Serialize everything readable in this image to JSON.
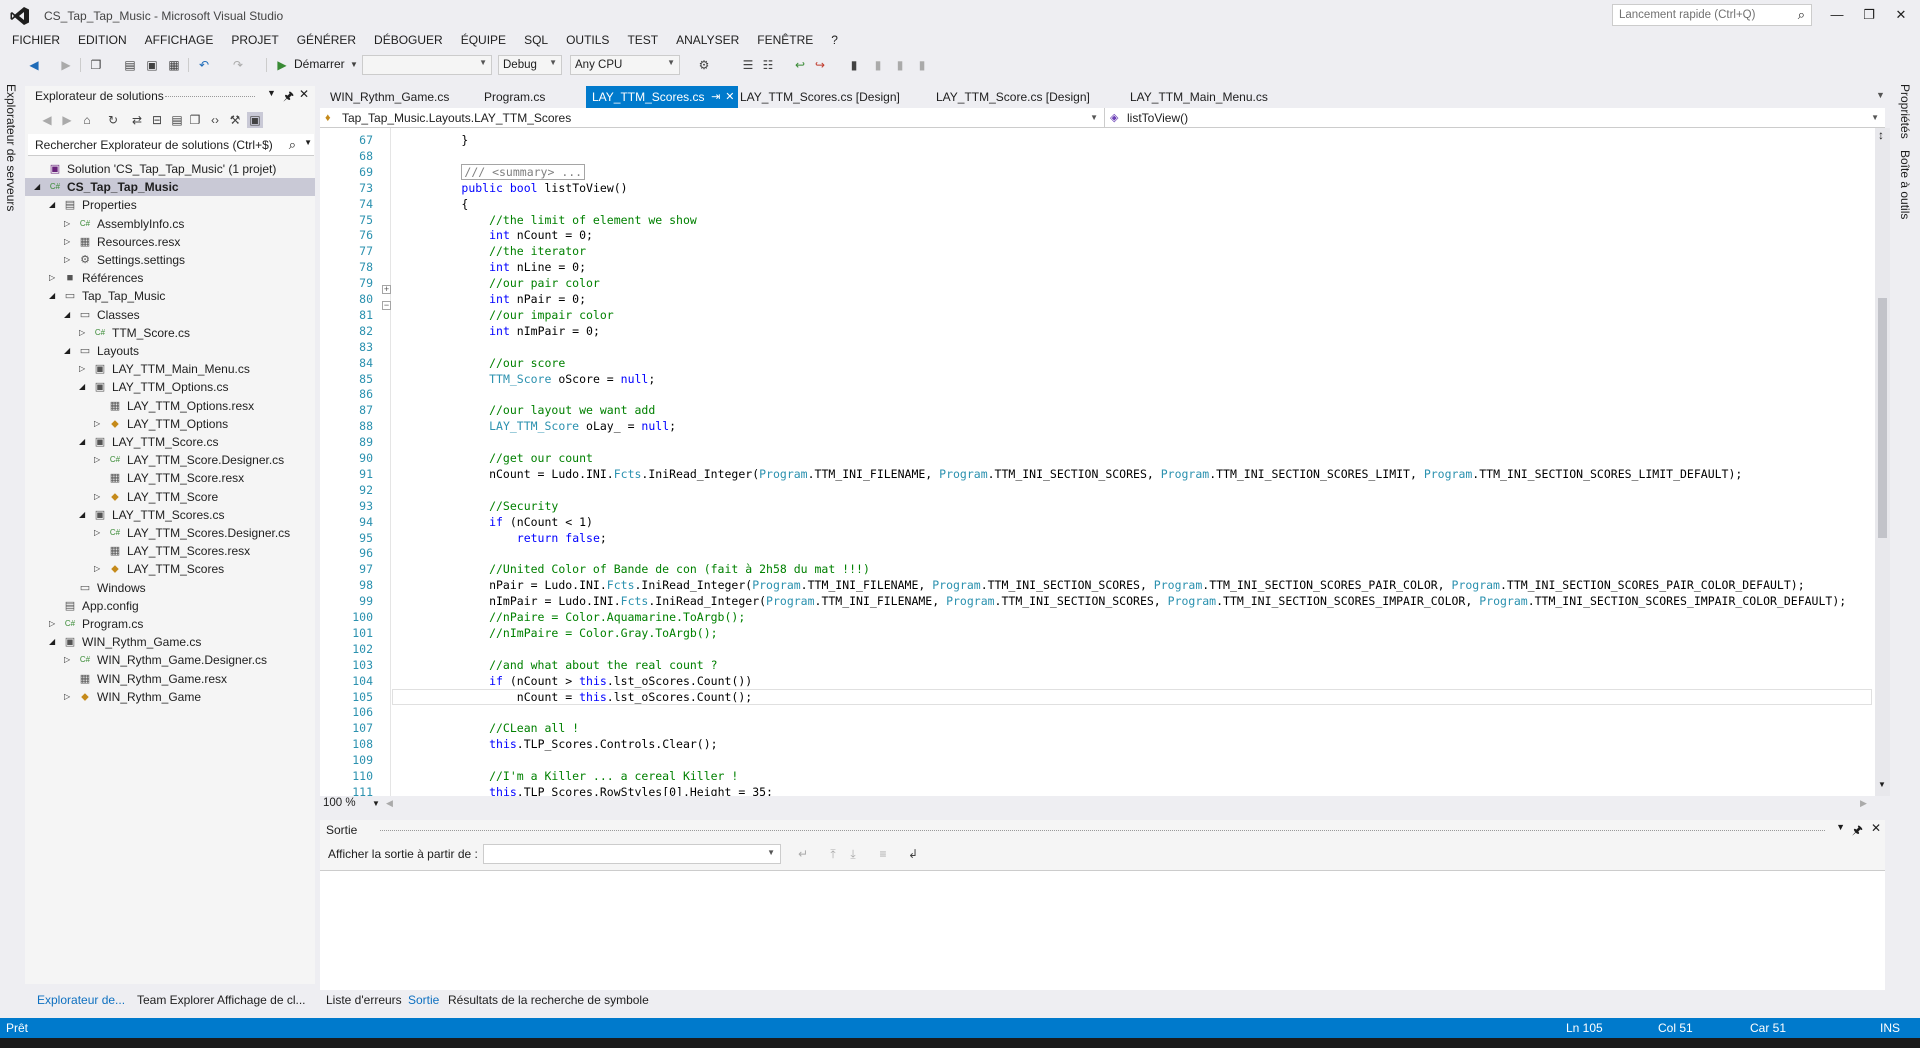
{
  "window": {
    "title": "CS_Tap_Tap_Music - Microsoft Visual Studio",
    "quick_launch_placeholder": "Lancement rapide (Ctrl+Q)"
  },
  "menu": [
    "FICHIER",
    "EDITION",
    "AFFICHAGE",
    "PROJET",
    "GÉNÉRER",
    "DÉBOGUER",
    "ÉQUIPE",
    "SQL",
    "OUTILS",
    "TEST",
    "ANALYSER",
    "FENÊTRE",
    "?"
  ],
  "toolbar": {
    "start_label": "Démarrer",
    "config": "Debug",
    "platform": "Any CPU",
    "target_combo": ""
  },
  "left_strip": {
    "server_explorer": "Explorateur de serveurs"
  },
  "right_strip": {
    "properties": "Propriétés",
    "toolbox": "Boîte à outils"
  },
  "solution_explorer": {
    "title": "Explorateur de solutions",
    "search_placeholder": "Rechercher Explorateur de solutions (Ctrl+$)",
    "tree": [
      {
        "label": "Solution 'CS_Tap_Tap_Music' (1 projet)",
        "icon": "solution-icon",
        "expander": "",
        "selected": false
      },
      {
        "label": "CS_Tap_Tap_Music",
        "icon": "csharp-project-icon",
        "expander": "◢",
        "selected": true
      },
      {
        "label": "Properties",
        "icon": "properties-folder-icon",
        "expander": "◢",
        "selected": false
      },
      {
        "label": "AssemblyInfo.cs",
        "icon": "csharp-file-icon",
        "expander": "▷",
        "selected": false
      },
      {
        "label": "Resources.resx",
        "icon": "resx-file-icon",
        "expander": "▷",
        "selected": false
      },
      {
        "label": "Settings.settings",
        "icon": "settings-file-icon",
        "expander": "▷",
        "selected": false
      },
      {
        "label": "Références",
        "icon": "references-icon",
        "expander": "▷",
        "selected": false
      },
      {
        "label": "Tap_Tap_Music",
        "icon": "folder-icon",
        "expander": "◢",
        "selected": false
      },
      {
        "label": "Classes",
        "icon": "folder-icon",
        "expander": "◢",
        "selected": false
      },
      {
        "label": "TTM_Score.cs",
        "icon": "csharp-file-icon",
        "expander": "▷",
        "selected": false
      },
      {
        "label": "Layouts",
        "icon": "folder-icon",
        "expander": "◢",
        "selected": false
      },
      {
        "label": "LAY_TTM_Main_Menu.cs",
        "icon": "form-file-icon",
        "expander": "▷",
        "selected": false
      },
      {
        "label": "LAY_TTM_Options.cs",
        "icon": "form-file-icon",
        "expander": "◢",
        "selected": false
      },
      {
        "label": "LAY_TTM_Options.resx",
        "icon": "resx-file-icon",
        "expander": "",
        "selected": false
      },
      {
        "label": "LAY_TTM_Options",
        "icon": "class-icon",
        "expander": "▷",
        "selected": false
      },
      {
        "label": "LAY_TTM_Score.cs",
        "icon": "form-file-icon",
        "expander": "◢",
        "selected": false
      },
      {
        "label": "LAY_TTM_Score.Designer.cs",
        "icon": "csharp-file-icon",
        "expander": "▷",
        "selected": false
      },
      {
        "label": "LAY_TTM_Score.resx",
        "icon": "resx-file-icon",
        "expander": "",
        "selected": false
      },
      {
        "label": "LAY_TTM_Score",
        "icon": "class-icon",
        "expander": "▷",
        "selected": false
      },
      {
        "label": "LAY_TTM_Scores.cs",
        "icon": "form-file-icon",
        "expander": "◢",
        "selected": false
      },
      {
        "label": "LAY_TTM_Scores.Designer.cs",
        "icon": "csharp-file-icon",
        "expander": "▷",
        "selected": false
      },
      {
        "label": "LAY_TTM_Scores.resx",
        "icon": "resx-file-icon",
        "expander": "",
        "selected": false
      },
      {
        "label": "LAY_TTM_Scores",
        "icon": "class-icon",
        "expander": "▷",
        "selected": false
      },
      {
        "label": "Windows",
        "icon": "folder-icon",
        "expander": "",
        "selected": false
      },
      {
        "label": "App.config",
        "icon": "config-file-icon",
        "expander": "",
        "selected": false
      },
      {
        "label": "Program.cs",
        "icon": "csharp-file-icon",
        "expander": "▷",
        "selected": false
      },
      {
        "label": "WIN_Rythm_Game.cs",
        "icon": "form-file-icon",
        "expander": "◢",
        "selected": false
      },
      {
        "label": "WIN_Rythm_Game.Designer.cs",
        "icon": "csharp-file-icon",
        "expander": "▷",
        "selected": false
      },
      {
        "label": "WIN_Rythm_Game.resx",
        "icon": "resx-file-icon",
        "expander": "",
        "selected": false
      },
      {
        "label": "WIN_Rythm_Game",
        "icon": "class-icon",
        "expander": "▷",
        "selected": false
      }
    ],
    "bottom_tabs": [
      "Explorateur de...",
      "Team Explorer",
      "Affichage de cl..."
    ]
  },
  "doc_tabs": [
    {
      "label": "WIN_Rythm_Game.cs",
      "active": false
    },
    {
      "label": "Program.cs",
      "active": false
    },
    {
      "label": "LAY_TTM_Scores.cs",
      "active": true
    },
    {
      "label": "LAY_TTM_Scores.cs [Design]",
      "active": false
    },
    {
      "label": "LAY_TTM_Score.cs [Design]",
      "active": false
    },
    {
      "label": "LAY_TTM_Main_Menu.cs",
      "active": false
    }
  ],
  "navbar": {
    "class_path": "Tap_Tap_Music.Layouts.LAY_TTM_Scores",
    "member": "listToView()"
  },
  "editor": {
    "zoom": "100 %",
    "lines": [
      {
        "n": "67",
        "tokens": [
          [
            "",
            "        }"
          ]
        ]
      },
      {
        "n": "68",
        "tokens": [
          [
            "",
            ""
          ]
        ]
      },
      {
        "n": "69",
        "tokens": [
          [
            "",
            "        "
          ],
          [
            "box",
            "/// <summary> ..."
          ]
        ]
      },
      {
        "n": "73",
        "tokens": [
          [
            "",
            "        "
          ],
          [
            "kw",
            "public"
          ],
          [
            "",
            " "
          ],
          [
            "kw",
            "bool"
          ],
          [
            "",
            " listToView()"
          ]
        ]
      },
      {
        "n": "74",
        "tokens": [
          [
            "",
            "        {"
          ]
        ]
      },
      {
        "n": "75",
        "tokens": [
          [
            "cm",
            "            //the limit of element we show"
          ]
        ]
      },
      {
        "n": "76",
        "tokens": [
          [
            "",
            "            "
          ],
          [
            "kw",
            "int"
          ],
          [
            "",
            " nCount = 0;"
          ]
        ]
      },
      {
        "n": "77",
        "tokens": [
          [
            "cm",
            "            //the iterator"
          ]
        ]
      },
      {
        "n": "78",
        "tokens": [
          [
            "",
            "            "
          ],
          [
            "kw",
            "int"
          ],
          [
            "",
            " nLine = 0;"
          ]
        ]
      },
      {
        "n": "79",
        "tokens": [
          [
            "cm",
            "            //our pair color"
          ]
        ]
      },
      {
        "n": "80",
        "tokens": [
          [
            "",
            "            "
          ],
          [
            "kw",
            "int"
          ],
          [
            "",
            " nPair = 0;"
          ]
        ]
      },
      {
        "n": "81",
        "tokens": [
          [
            "cm",
            "            //our impair color"
          ]
        ]
      },
      {
        "n": "82",
        "tokens": [
          [
            "",
            "            "
          ],
          [
            "kw",
            "int"
          ],
          [
            "",
            " nImPair = 0;"
          ]
        ]
      },
      {
        "n": "83",
        "tokens": [
          [
            "",
            ""
          ]
        ]
      },
      {
        "n": "84",
        "tokens": [
          [
            "cm",
            "            //our score"
          ]
        ]
      },
      {
        "n": "85",
        "tokens": [
          [
            "",
            "            "
          ],
          [
            "ty",
            "TTM_Score"
          ],
          [
            "",
            " oScore = "
          ],
          [
            "kw",
            "null"
          ],
          [
            "",
            ";"
          ]
        ]
      },
      {
        "n": "86",
        "tokens": [
          [
            "",
            ""
          ]
        ]
      },
      {
        "n": "87",
        "tokens": [
          [
            "cm",
            "            //our layout we want add"
          ]
        ]
      },
      {
        "n": "88",
        "tokens": [
          [
            "",
            "            "
          ],
          [
            "ty",
            "LAY_TTM_Score"
          ],
          [
            "",
            " oLay_ = "
          ],
          [
            "kw",
            "null"
          ],
          [
            "",
            ";"
          ]
        ]
      },
      {
        "n": "89",
        "tokens": [
          [
            "",
            ""
          ]
        ]
      },
      {
        "n": "90",
        "tokens": [
          [
            "cm",
            "            //get our count"
          ]
        ]
      },
      {
        "n": "91",
        "tokens": [
          [
            "",
            "            nCount = Ludo.INI."
          ],
          [
            "ty",
            "Fcts"
          ],
          [
            "",
            ".IniRead_Integer("
          ],
          [
            "ty",
            "Program"
          ],
          [
            "",
            ".TTM_INI_FILENAME, "
          ],
          [
            "ty",
            "Program"
          ],
          [
            "",
            ".TTM_INI_SECTION_SCORES, "
          ],
          [
            "ty",
            "Program"
          ],
          [
            "",
            ".TTM_INI_SECTION_SCORES_LIMIT, "
          ],
          [
            "ty",
            "Program"
          ],
          [
            "",
            ".TTM_INI_SECTION_SCORES_LIMIT_DEFAULT);"
          ]
        ]
      },
      {
        "n": "92",
        "tokens": [
          [
            "",
            ""
          ]
        ]
      },
      {
        "n": "93",
        "tokens": [
          [
            "cm",
            "            //Security"
          ]
        ]
      },
      {
        "n": "94",
        "tokens": [
          [
            "",
            "            "
          ],
          [
            "kw",
            "if"
          ],
          [
            "",
            " (nCount < 1)"
          ]
        ]
      },
      {
        "n": "95",
        "tokens": [
          [
            "",
            "                "
          ],
          [
            "kw",
            "return"
          ],
          [
            "",
            " "
          ],
          [
            "kw",
            "false"
          ],
          [
            "",
            ";"
          ]
        ]
      },
      {
        "n": "96",
        "tokens": [
          [
            "",
            ""
          ]
        ]
      },
      {
        "n": "97",
        "tokens": [
          [
            "cm",
            "            //United Color of Bande de con (fait à 2h58 du mat !!!)"
          ]
        ]
      },
      {
        "n": "98",
        "tokens": [
          [
            "",
            "            nPair = Ludo.INI."
          ],
          [
            "ty",
            "Fcts"
          ],
          [
            "",
            ".IniRead_Integer("
          ],
          [
            "ty",
            "Program"
          ],
          [
            "",
            ".TTM_INI_FILENAME, "
          ],
          [
            "ty",
            "Program"
          ],
          [
            "",
            ".TTM_INI_SECTION_SCORES, "
          ],
          [
            "ty",
            "Program"
          ],
          [
            "",
            ".TTM_INI_SECTION_SCORES_PAIR_COLOR, "
          ],
          [
            "ty",
            "Program"
          ],
          [
            "",
            ".TTM_INI_SECTION_SCORES_PAIR_COLOR_DEFAULT);"
          ]
        ]
      },
      {
        "n": "99",
        "tokens": [
          [
            "",
            "            nImPair = Ludo.INI."
          ],
          [
            "ty",
            "Fcts"
          ],
          [
            "",
            ".IniRead_Integer("
          ],
          [
            "ty",
            "Program"
          ],
          [
            "",
            ".TTM_INI_FILENAME, "
          ],
          [
            "ty",
            "Program"
          ],
          [
            "",
            ".TTM_INI_SECTION_SCORES, "
          ],
          [
            "ty",
            "Program"
          ],
          [
            "",
            ".TTM_INI_SECTION_SCORES_IMPAIR_COLOR, "
          ],
          [
            "ty",
            "Program"
          ],
          [
            "",
            ".TTM_INI_SECTION_SCORES_IMPAIR_COLOR_DEFAULT);"
          ]
        ]
      },
      {
        "n": "100",
        "tokens": [
          [
            "cm",
            "            //nPaire = Color.Aquamarine.ToArgb();"
          ]
        ]
      },
      {
        "n": "101",
        "tokens": [
          [
            "cm",
            "            //nImPaire = Color.Gray.ToArgb();"
          ]
        ]
      },
      {
        "n": "102",
        "tokens": [
          [
            "",
            ""
          ]
        ]
      },
      {
        "n": "103",
        "tokens": [
          [
            "cm",
            "            //and what about the real count ?"
          ]
        ]
      },
      {
        "n": "104",
        "tokens": [
          [
            "",
            "            "
          ],
          [
            "kw",
            "if"
          ],
          [
            "",
            " (nCount > "
          ],
          [
            "kw",
            "this"
          ],
          [
            "",
            ".lst_oScores.Count())"
          ]
        ]
      },
      {
        "n": "105",
        "tokens": [
          [
            "",
            "                nCount = "
          ],
          [
            "kw",
            "this"
          ],
          [
            "",
            ".lst_oScores.Count();"
          ]
        ]
      },
      {
        "n": "106",
        "tokens": [
          [
            "",
            ""
          ]
        ]
      },
      {
        "n": "107",
        "tokens": [
          [
            "cm",
            "            //CLean all !"
          ]
        ]
      },
      {
        "n": "108",
        "tokens": [
          [
            "",
            "            "
          ],
          [
            "kw",
            "this"
          ],
          [
            "",
            ".TLP_Scores.Controls.Clear();"
          ]
        ]
      },
      {
        "n": "109",
        "tokens": [
          [
            "",
            ""
          ]
        ]
      },
      {
        "n": "110",
        "tokens": [
          [
            "cm",
            "            //I'm a Killer ... a cereal Killer !"
          ]
        ]
      },
      {
        "n": "111",
        "tokens": [
          [
            "",
            "            "
          ],
          [
            "kw",
            "this"
          ],
          [
            "",
            ".TLP_Scores.RowStyles[0].Height = 35;"
          ]
        ]
      }
    ]
  },
  "output": {
    "title": "Sortie",
    "show_from_label": "Afficher la sortie à partir de :",
    "source": ""
  },
  "bottom_tabs": [
    "Liste d'erreurs",
    "Sortie",
    "Résultats de la recherche de symbole"
  ],
  "statusbar": {
    "status": "Prêt",
    "line": "Ln 105",
    "col": "Col 51",
    "char": "Car 51",
    "mode": "INS"
  },
  "colors": {
    "accent": "#007acc",
    "keyword": "#0000ff",
    "comment": "#008000",
    "type": "#2b91af",
    "line_number": "#2b91af"
  }
}
